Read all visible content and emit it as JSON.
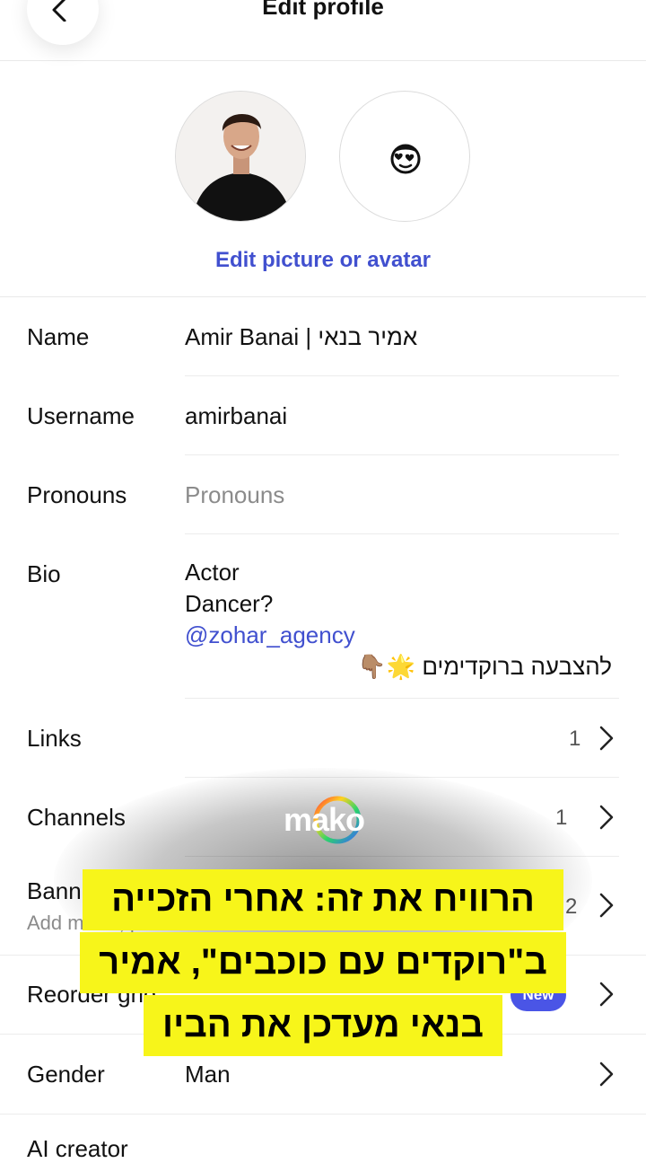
{
  "header": {
    "title": "Edit profile"
  },
  "avatar": {
    "edit_label": "Edit picture or avatar"
  },
  "fields": {
    "name": {
      "label": "Name",
      "value": "Amir Banai | אמיר בנאי"
    },
    "username": {
      "label": "Username",
      "value": "amirbanai"
    },
    "pronouns": {
      "label": "Pronouns",
      "placeholder": "Pronouns"
    },
    "bio": {
      "label": "Bio",
      "line1": "Actor",
      "line2": "Dancer?",
      "mention": "@zohar_agency",
      "line4": "להצבעה ברוקדימים 🌟👇🏽"
    }
  },
  "links_row": {
    "label": "Links",
    "count": "1"
  },
  "channels_row": {
    "label": "Channels",
    "count": "1"
  },
  "banners_row": {
    "label": "Bann",
    "subtext": "Add music, profiles and more.",
    "count": "2"
  },
  "reorder_row": {
    "label": "Reorder grid",
    "badge": "New"
  },
  "gender_row": {
    "label": "Gender",
    "value": "Man"
  },
  "ai_row": {
    "label": "AI creator"
  },
  "overlay": {
    "logo_text": "mako",
    "caption_line1": "הרוויח את זה: אחרי הזכייה",
    "caption_line2": "ב\"רוקדים עם כוכבים\", אמיר",
    "caption_line3": "בנאי מעדכן את הביו"
  },
  "colors": {
    "accent": "#4150cf",
    "badge": "#4a55e6",
    "caption_bg": "#f7f51a"
  }
}
